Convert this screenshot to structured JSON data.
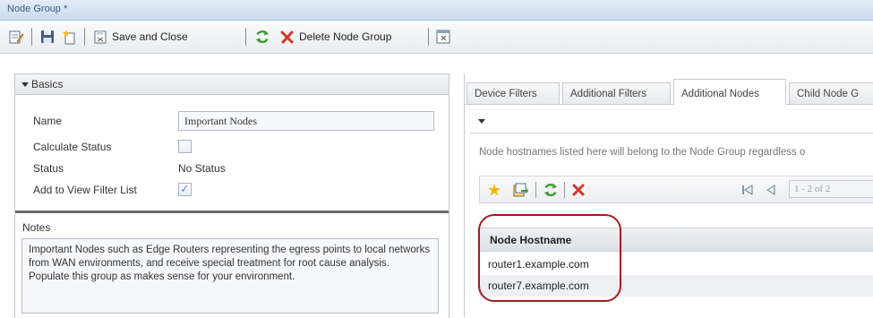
{
  "window": {
    "title": "Node Group *"
  },
  "toolbar": {
    "save_close_label": "Save and Close",
    "delete_label": "Delete Node Group"
  },
  "basics": {
    "section_title": "Basics",
    "name_label": "Name",
    "name_value": "Important Nodes",
    "calc_status_label": "Calculate Status",
    "calc_status_checked": false,
    "status_label": "Status",
    "status_value": "No Status",
    "add_filter_label": "Add to View Filter List",
    "add_filter_checked": true,
    "notes_label": "Notes",
    "notes_value": "Important Nodes such as Edge Routers representing the egress points to local networks from WAN environments, and receive special treatment for root cause analysis.  Populate this group as makes sense for your environment."
  },
  "tabs": [
    {
      "label": "Device Filters",
      "active": false
    },
    {
      "label": "Additional Filters",
      "active": false
    },
    {
      "label": "Additional Nodes",
      "active": true
    },
    {
      "label": "Child Node G",
      "active": false
    }
  ],
  "additional_nodes": {
    "description": "Node hostnames listed here will belong to the Node Group regardless o",
    "pager_text": "1 - 2 of 2",
    "column_header": "Node Hostname",
    "rows": [
      "router1.example.com",
      "router7.example.com"
    ]
  },
  "colors": {
    "highlight_circle": "#a11e22",
    "refresh_green": "#3b9a2b",
    "delete_red": "#d9342b",
    "new_star": "#f2b705"
  }
}
